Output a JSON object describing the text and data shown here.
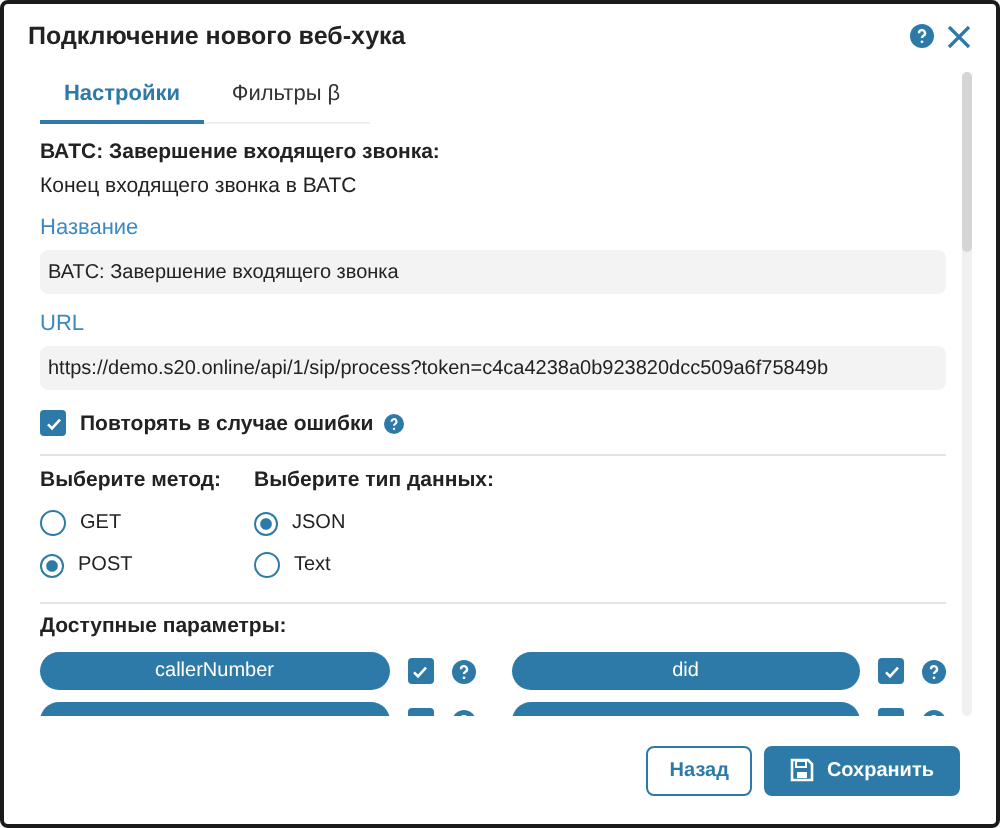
{
  "dialog": {
    "title": "Подключение нового веб-хука"
  },
  "tabs": [
    {
      "label": "Настройки",
      "selected": true
    },
    {
      "label": "Фильтры β",
      "selected": false
    }
  ],
  "event": {
    "title": "ВАТС: Завершение входящего звонка:",
    "description": "Конец входящего звонка в ВАТС"
  },
  "fields": [
    {
      "label": "Название",
      "value": "ВАТС: Завершение входящего звонка"
    },
    {
      "label": "URL",
      "value": "https://demo.s20.online/api/1/sip/process?token=c4ca4238a0b923820dcc509a6f75849b"
    }
  ],
  "retry": {
    "label": "Повторять в случае ошибки",
    "checked": true
  },
  "method": {
    "heading": "Выберите метод:",
    "options": [
      {
        "label": "GET",
        "selected": false
      },
      {
        "label": "POST",
        "selected": true
      }
    ]
  },
  "data_type": {
    "heading": "Выберите тип данных:",
    "options": [
      {
        "label": "JSON",
        "selected": true
      },
      {
        "label": "Text",
        "selected": false
      }
    ]
  },
  "params": {
    "heading": "Доступные параметры:",
    "items": [
      {
        "name": "callerNumber",
        "checked": true
      },
      {
        "name": "did",
        "checked": true
      },
      {
        "checked": true
      },
      {
        "checked": true
      }
    ]
  },
  "buttons": [
    {
      "label": "Назад",
      "kind": "secondary"
    },
    {
      "label": "Сохранить",
      "kind": "primary"
    }
  ]
}
